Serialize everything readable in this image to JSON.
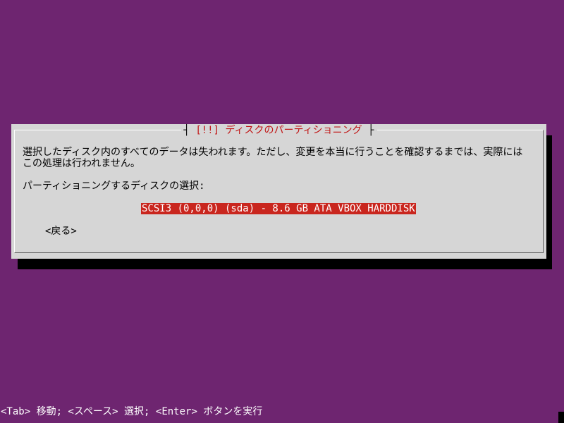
{
  "dialog": {
    "title_prefix": "[!!]",
    "title": "ディスクのパーティショニング",
    "message": "選択したディスク内のすべてのデータは失われます。ただし、変更を本当に行うことを確認するまでは、実際にはこの処理は行われません。",
    "prompt": "パーティショニングするディスクの選択:",
    "disks": [
      "SCSI3 (0,0,0) (sda) - 8.6 GB ATA VBOX HARDDISK"
    ],
    "back_label": "<戻る>"
  },
  "statusbar": {
    "text": "<Tab> 移動; <スペース> 選択; <Enter> ボタンを実行"
  },
  "colors": {
    "background": "#6e2570",
    "dialog": "#d6d6d6",
    "title": "#c11515",
    "selection": "#c9261e"
  }
}
